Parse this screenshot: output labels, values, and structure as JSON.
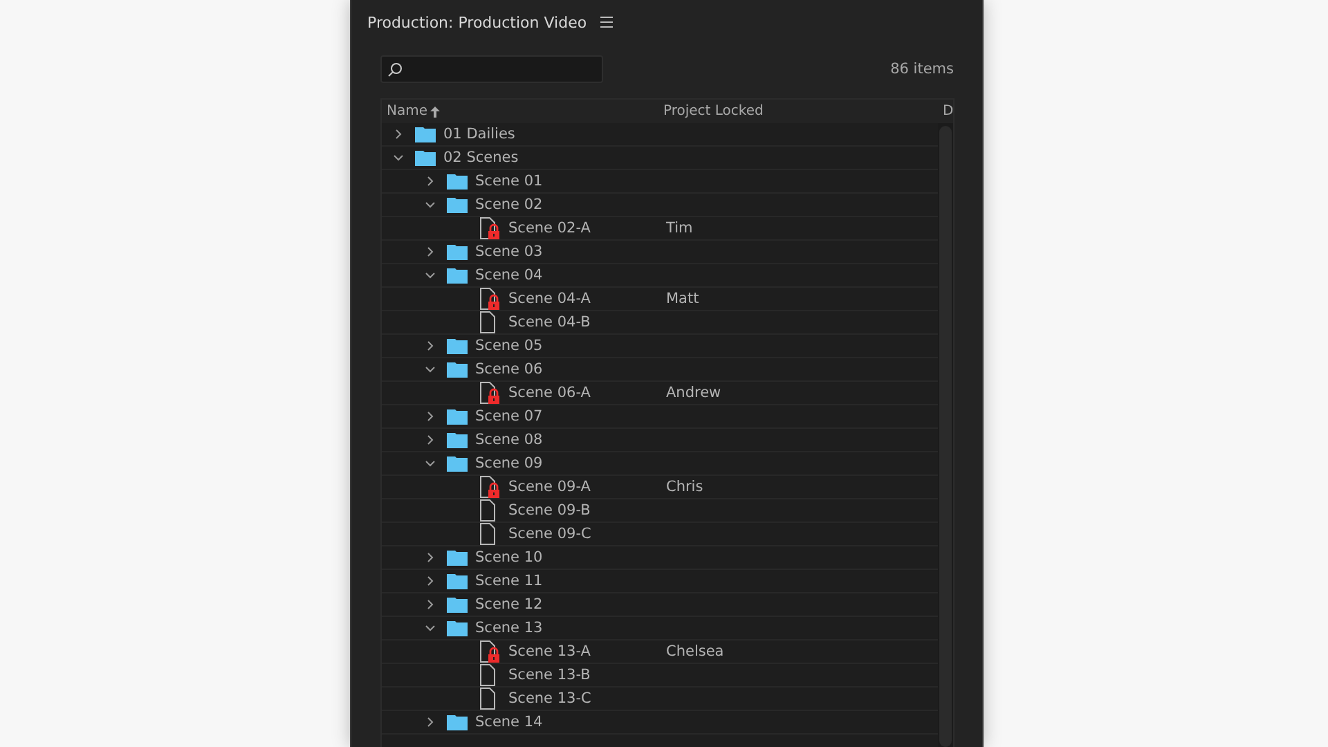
{
  "panel": {
    "title": "Production: Production Video"
  },
  "item_count": "86 items",
  "columns": [
    {
      "label": "Name",
      "sorted": true
    },
    {
      "label": "Project Locked",
      "sorted": false
    },
    {
      "label": "D",
      "sorted": false
    }
  ],
  "tree": [
    {
      "kind": "folder",
      "name": "01 Dailies",
      "expanded": false
    },
    {
      "kind": "folder",
      "name": "02 Scenes",
      "expanded": true,
      "children": [
        {
          "kind": "folder",
          "name": "Scene 01",
          "expanded": false
        },
        {
          "kind": "folder",
          "name": "Scene 02",
          "expanded": true,
          "children": [
            {
              "kind": "file",
              "name": "Scene 02-A",
              "locked": true,
              "locked_by": "Tim"
            }
          ]
        },
        {
          "kind": "folder",
          "name": "Scene 03",
          "expanded": false
        },
        {
          "kind": "folder",
          "name": "Scene 04",
          "expanded": true,
          "children": [
            {
              "kind": "file",
              "name": "Scene 04-A",
              "locked": true,
              "locked_by": "Matt"
            },
            {
              "kind": "file",
              "name": "Scene 04-B",
              "locked": false
            }
          ]
        },
        {
          "kind": "folder",
          "name": "Scene 05",
          "expanded": false
        },
        {
          "kind": "folder",
          "name": "Scene 06",
          "expanded": true,
          "children": [
            {
              "kind": "file",
              "name": "Scene 06-A",
              "locked": true,
              "locked_by": "Andrew"
            }
          ]
        },
        {
          "kind": "folder",
          "name": "Scene 07",
          "expanded": false
        },
        {
          "kind": "folder",
          "name": "Scene 08",
          "expanded": false
        },
        {
          "kind": "folder",
          "name": "Scene 09",
          "expanded": true,
          "children": [
            {
              "kind": "file",
              "name": "Scene 09-A",
              "locked": true,
              "locked_by": "Chris"
            },
            {
              "kind": "file",
              "name": "Scene 09-B",
              "locked": false
            },
            {
              "kind": "file",
              "name": "Scene 09-C",
              "locked": false
            }
          ]
        },
        {
          "kind": "folder",
          "name": "Scene 10",
          "expanded": false
        },
        {
          "kind": "folder",
          "name": "Scene 11",
          "expanded": false
        },
        {
          "kind": "folder",
          "name": "Scene 12",
          "expanded": false
        },
        {
          "kind": "folder",
          "name": "Scene 13",
          "expanded": true,
          "children": [
            {
              "kind": "file",
              "name": "Scene 13-A",
              "locked": true,
              "locked_by": "Chelsea"
            },
            {
              "kind": "file",
              "name": "Scene 13-B",
              "locked": false
            },
            {
              "kind": "file",
              "name": "Scene 13-C",
              "locked": false
            }
          ]
        },
        {
          "kind": "folder",
          "name": "Scene 14",
          "expanded": false
        }
      ]
    }
  ]
}
